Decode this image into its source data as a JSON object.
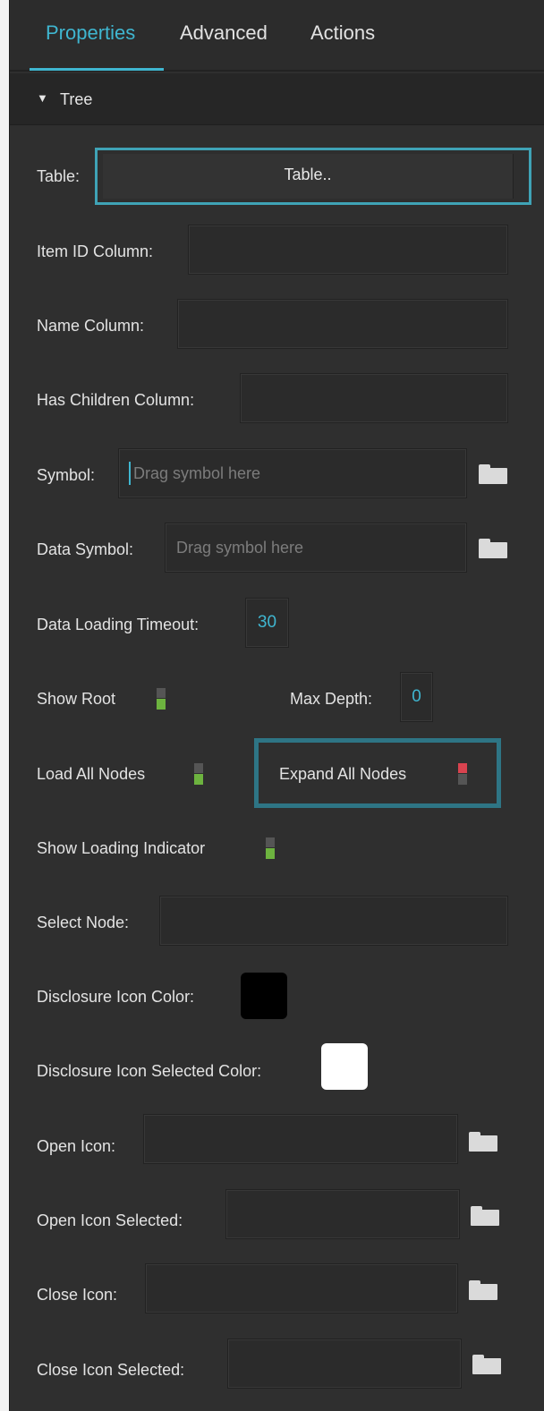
{
  "tabs": [
    {
      "label": "Properties",
      "active": true
    },
    {
      "label": "Advanced",
      "active": false
    },
    {
      "label": "Actions",
      "active": false
    }
  ],
  "section": {
    "title": "Tree",
    "expanded": true
  },
  "fields": {
    "table": {
      "label": "Table:",
      "button_label": "Table.."
    },
    "item_id_column": {
      "label": "Item ID Column:",
      "value": ""
    },
    "name_column": {
      "label": "Name Column:",
      "value": ""
    },
    "has_children_column": {
      "label": "Has Children Column:",
      "value": ""
    },
    "symbol": {
      "label": "Symbol:",
      "placeholder": "Drag symbol here"
    },
    "data_symbol": {
      "label": "Data Symbol:",
      "placeholder": "Drag symbol here"
    },
    "data_loading_timeout": {
      "label": "Data Loading Timeout:",
      "value": "30"
    },
    "show_root": {
      "label": "Show Root",
      "on": true
    },
    "max_depth": {
      "label": "Max Depth:",
      "value": "0"
    },
    "load_all_nodes": {
      "label": "Load All Nodes",
      "on": true
    },
    "expand_all_nodes": {
      "label": "Expand All Nodes",
      "on": false
    },
    "show_loading_indicator": {
      "label": "Show Loading Indicator",
      "on": true
    },
    "select_node": {
      "label": "Select Node:",
      "value": ""
    },
    "disclosure_icon_color": {
      "label": "Disclosure Icon Color:",
      "color": "#000000"
    },
    "disclosure_icon_selected_color": {
      "label": "Disclosure Icon Selected Color:",
      "color": "#ffffff"
    },
    "open_icon": {
      "label": "Open Icon:",
      "value": ""
    },
    "open_icon_selected": {
      "label": "Open Icon Selected:",
      "value": ""
    },
    "close_icon": {
      "label": "Close Icon:",
      "value": ""
    },
    "close_icon_selected": {
      "label": "Close Icon Selected:",
      "value": ""
    }
  },
  "colors": {
    "accent": "#3fb6d0",
    "toggle_on": "#6db33f",
    "toggle_off": "#d9434f",
    "highlight": "#2e7585"
  }
}
